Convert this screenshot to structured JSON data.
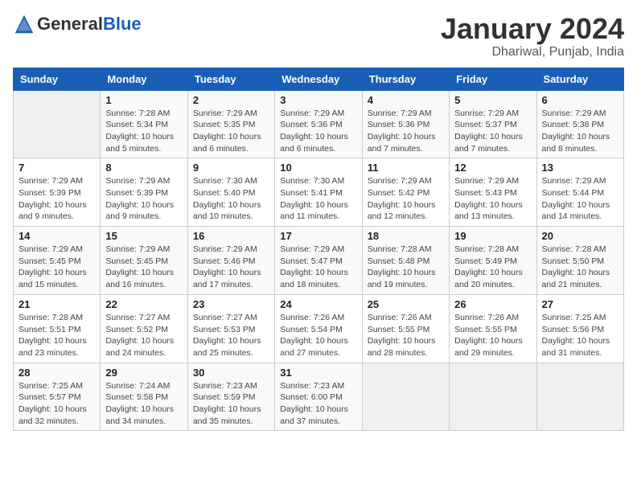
{
  "header": {
    "logo_general": "General",
    "logo_blue": "Blue",
    "month": "January 2024",
    "location": "Dhariwal, Punjab, India"
  },
  "weekdays": [
    "Sunday",
    "Monday",
    "Tuesday",
    "Wednesday",
    "Thursday",
    "Friday",
    "Saturday"
  ],
  "weeks": [
    [
      {
        "day": "",
        "info": ""
      },
      {
        "day": "1",
        "info": "Sunrise: 7:28 AM\nSunset: 5:34 PM\nDaylight: 10 hours\nand 5 minutes."
      },
      {
        "day": "2",
        "info": "Sunrise: 7:29 AM\nSunset: 5:35 PM\nDaylight: 10 hours\nand 6 minutes."
      },
      {
        "day": "3",
        "info": "Sunrise: 7:29 AM\nSunset: 5:36 PM\nDaylight: 10 hours\nand 6 minutes."
      },
      {
        "day": "4",
        "info": "Sunrise: 7:29 AM\nSunset: 5:36 PM\nDaylight: 10 hours\nand 7 minutes."
      },
      {
        "day": "5",
        "info": "Sunrise: 7:29 AM\nSunset: 5:37 PM\nDaylight: 10 hours\nand 7 minutes."
      },
      {
        "day": "6",
        "info": "Sunrise: 7:29 AM\nSunset: 5:38 PM\nDaylight: 10 hours\nand 8 minutes."
      }
    ],
    [
      {
        "day": "7",
        "info": "Sunrise: 7:29 AM\nSunset: 5:39 PM\nDaylight: 10 hours\nand 9 minutes."
      },
      {
        "day": "8",
        "info": "Sunrise: 7:29 AM\nSunset: 5:39 PM\nDaylight: 10 hours\nand 9 minutes."
      },
      {
        "day": "9",
        "info": "Sunrise: 7:30 AM\nSunset: 5:40 PM\nDaylight: 10 hours\nand 10 minutes."
      },
      {
        "day": "10",
        "info": "Sunrise: 7:30 AM\nSunset: 5:41 PM\nDaylight: 10 hours\nand 11 minutes."
      },
      {
        "day": "11",
        "info": "Sunrise: 7:29 AM\nSunset: 5:42 PM\nDaylight: 10 hours\nand 12 minutes."
      },
      {
        "day": "12",
        "info": "Sunrise: 7:29 AM\nSunset: 5:43 PM\nDaylight: 10 hours\nand 13 minutes."
      },
      {
        "day": "13",
        "info": "Sunrise: 7:29 AM\nSunset: 5:44 PM\nDaylight: 10 hours\nand 14 minutes."
      }
    ],
    [
      {
        "day": "14",
        "info": "Sunrise: 7:29 AM\nSunset: 5:45 PM\nDaylight: 10 hours\nand 15 minutes."
      },
      {
        "day": "15",
        "info": "Sunrise: 7:29 AM\nSunset: 5:45 PM\nDaylight: 10 hours\nand 16 minutes."
      },
      {
        "day": "16",
        "info": "Sunrise: 7:29 AM\nSunset: 5:46 PM\nDaylight: 10 hours\nand 17 minutes."
      },
      {
        "day": "17",
        "info": "Sunrise: 7:29 AM\nSunset: 5:47 PM\nDaylight: 10 hours\nand 18 minutes."
      },
      {
        "day": "18",
        "info": "Sunrise: 7:28 AM\nSunset: 5:48 PM\nDaylight: 10 hours\nand 19 minutes."
      },
      {
        "day": "19",
        "info": "Sunrise: 7:28 AM\nSunset: 5:49 PM\nDaylight: 10 hours\nand 20 minutes."
      },
      {
        "day": "20",
        "info": "Sunrise: 7:28 AM\nSunset: 5:50 PM\nDaylight: 10 hours\nand 21 minutes."
      }
    ],
    [
      {
        "day": "21",
        "info": "Sunrise: 7:28 AM\nSunset: 5:51 PM\nDaylight: 10 hours\nand 23 minutes."
      },
      {
        "day": "22",
        "info": "Sunrise: 7:27 AM\nSunset: 5:52 PM\nDaylight: 10 hours\nand 24 minutes."
      },
      {
        "day": "23",
        "info": "Sunrise: 7:27 AM\nSunset: 5:53 PM\nDaylight: 10 hours\nand 25 minutes."
      },
      {
        "day": "24",
        "info": "Sunrise: 7:26 AM\nSunset: 5:54 PM\nDaylight: 10 hours\nand 27 minutes."
      },
      {
        "day": "25",
        "info": "Sunrise: 7:26 AM\nSunset: 5:55 PM\nDaylight: 10 hours\nand 28 minutes."
      },
      {
        "day": "26",
        "info": "Sunrise: 7:26 AM\nSunset: 5:55 PM\nDaylight: 10 hours\nand 29 minutes."
      },
      {
        "day": "27",
        "info": "Sunrise: 7:25 AM\nSunset: 5:56 PM\nDaylight: 10 hours\nand 31 minutes."
      }
    ],
    [
      {
        "day": "28",
        "info": "Sunrise: 7:25 AM\nSunset: 5:57 PM\nDaylight: 10 hours\nand 32 minutes."
      },
      {
        "day": "29",
        "info": "Sunrise: 7:24 AM\nSunset: 5:58 PM\nDaylight: 10 hours\nand 34 minutes."
      },
      {
        "day": "30",
        "info": "Sunrise: 7:23 AM\nSunset: 5:59 PM\nDaylight: 10 hours\nand 35 minutes."
      },
      {
        "day": "31",
        "info": "Sunrise: 7:23 AM\nSunset: 6:00 PM\nDaylight: 10 hours\nand 37 minutes."
      },
      {
        "day": "",
        "info": ""
      },
      {
        "day": "",
        "info": ""
      },
      {
        "day": "",
        "info": ""
      }
    ]
  ]
}
